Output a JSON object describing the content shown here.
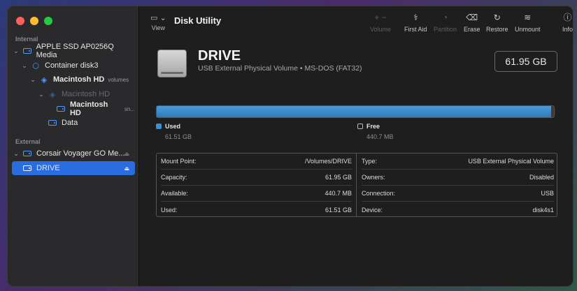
{
  "sidebar": {
    "internal_label": "Internal",
    "external_label": "External",
    "items": [
      {
        "label": "APPLE SSD AP0256Q Media"
      },
      {
        "label": "Container disk3"
      },
      {
        "label": "Macintosh HD",
        "sub": "volumes"
      },
      {
        "label": "Macintosh HD"
      },
      {
        "label": "Macintosh HD",
        "sub": "sn..."
      },
      {
        "label": "Data"
      },
      {
        "label": "Corsair Voyager GO Me..."
      },
      {
        "label": "DRIVE"
      }
    ]
  },
  "toolbar": {
    "view_label": "View",
    "title": "Disk Utility",
    "volume_label": "Volume",
    "first_aid_label": "First Aid",
    "partition_label": "Partition",
    "erase_label": "Erase",
    "restore_label": "Restore",
    "unmount_label": "Unmount",
    "info_label": "Info"
  },
  "drive": {
    "name": "DRIVE",
    "description": "USB External Physical Volume • MS-DOS (FAT32)",
    "size": "61.95 GB",
    "used_fraction": 0.993
  },
  "usage": {
    "used_label": "Used",
    "used_value": "61.51 GB",
    "free_label": "Free",
    "free_value": "440.7 MB",
    "used_color": "#3d8fd0"
  },
  "info": {
    "left": [
      {
        "key": "Mount Point:",
        "value": "/Volumes/DRIVE"
      },
      {
        "key": "Capacity:",
        "value": "61.95 GB"
      },
      {
        "key": "Available:",
        "value": "440.7 MB"
      },
      {
        "key": "Used:",
        "value": "61.51 GB"
      }
    ],
    "right": [
      {
        "key": "Type:",
        "value": "USB External Physical Volume"
      },
      {
        "key": "Owners:",
        "value": "Disabled"
      },
      {
        "key": "Connection:",
        "value": "USB"
      },
      {
        "key": "Device:",
        "value": "disk4s1"
      }
    ]
  }
}
